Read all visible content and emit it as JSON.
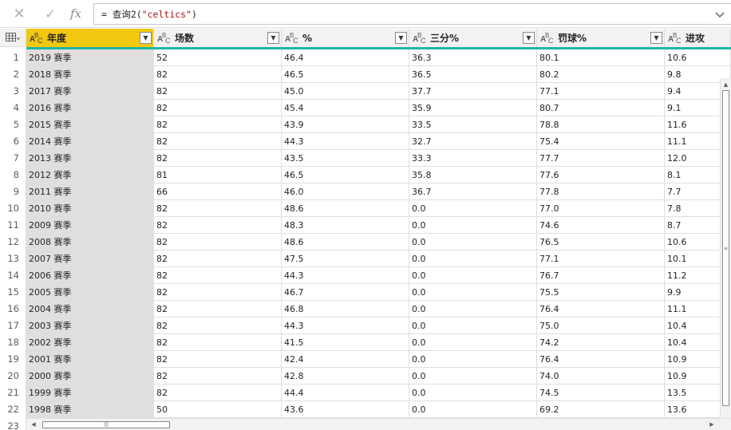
{
  "formula_bar": {
    "cancel_icon": "close-icon",
    "commit_icon": "check-icon",
    "fx_label": "fx",
    "formula_prefix": "= 查询2(",
    "formula_string": "\"celtics\"",
    "formula_suffix": ")"
  },
  "table": {
    "columns": [
      {
        "name": "年度",
        "type": "text",
        "selected": true
      },
      {
        "name": "场数",
        "type": "text"
      },
      {
        "name": "%",
        "type": "text"
      },
      {
        "name": "三分%",
        "type": "text"
      },
      {
        "name": "罚球%",
        "type": "text"
      },
      {
        "name": "进攻",
        "type": "text"
      }
    ],
    "rows": [
      {
        "n": "1",
        "c": [
          "2019 赛季",
          "52",
          "46.4",
          "36.3",
          "80.1",
          "10.6"
        ]
      },
      {
        "n": "2",
        "c": [
          "2018 赛季",
          "82",
          "46.5",
          "36.5",
          "80.2",
          "9.8"
        ]
      },
      {
        "n": "3",
        "c": [
          "2017 赛季",
          "82",
          "45.0",
          "37.7",
          "77.1",
          "9.4"
        ]
      },
      {
        "n": "4",
        "c": [
          "2016 赛季",
          "82",
          "45.4",
          "35.9",
          "80.7",
          "9.1"
        ]
      },
      {
        "n": "5",
        "c": [
          "2015 赛季",
          "82",
          "43.9",
          "33.5",
          "78.8",
          "11.6"
        ]
      },
      {
        "n": "6",
        "c": [
          "2014 赛季",
          "82",
          "44.3",
          "32.7",
          "75.4",
          "11.1"
        ]
      },
      {
        "n": "7",
        "c": [
          "2013 赛季",
          "82",
          "43.5",
          "33.3",
          "77.7",
          "12.0"
        ]
      },
      {
        "n": "8",
        "c": [
          "2012 赛季",
          "81",
          "46.5",
          "35.8",
          "77.6",
          "8.1"
        ]
      },
      {
        "n": "9",
        "c": [
          "2011 赛季",
          "66",
          "46.0",
          "36.7",
          "77.8",
          "7.7"
        ]
      },
      {
        "n": "10",
        "c": [
          "2010 赛季",
          "82",
          "48.6",
          "0.0",
          "77.0",
          "7.8"
        ]
      },
      {
        "n": "11",
        "c": [
          "2009 赛季",
          "82",
          "48.3",
          "0.0",
          "74.6",
          "8.7"
        ]
      },
      {
        "n": "12",
        "c": [
          "2008 赛季",
          "82",
          "48.6",
          "0.0",
          "76.5",
          "10.6"
        ]
      },
      {
        "n": "13",
        "c": [
          "2007 赛季",
          "82",
          "47.5",
          "0.0",
          "77.1",
          "10.1"
        ]
      },
      {
        "n": "14",
        "c": [
          "2006 赛季",
          "82",
          "44.3",
          "0.0",
          "76.7",
          "11.2"
        ]
      },
      {
        "n": "15",
        "c": [
          "2005 赛季",
          "82",
          "46.7",
          "0.0",
          "75.5",
          "9.9"
        ]
      },
      {
        "n": "16",
        "c": [
          "2004 赛季",
          "82",
          "46.8",
          "0.0",
          "76.4",
          "11.1"
        ]
      },
      {
        "n": "17",
        "c": [
          "2003 赛季",
          "82",
          "44.3",
          "0.0",
          "75.0",
          "10.4"
        ]
      },
      {
        "n": "18",
        "c": [
          "2002 赛季",
          "82",
          "41.5",
          "0.0",
          "74.2",
          "10.4"
        ]
      },
      {
        "n": "19",
        "c": [
          "2001 赛季",
          "82",
          "42.4",
          "0.0",
          "76.4",
          "10.9"
        ]
      },
      {
        "n": "20",
        "c": [
          "2000 赛季",
          "82",
          "42.8",
          "0.0",
          "74.0",
          "10.9"
        ]
      },
      {
        "n": "21",
        "c": [
          "1999 赛季",
          "82",
          "44.4",
          "0.0",
          "74.5",
          "13.5"
        ]
      },
      {
        "n": "22",
        "c": [
          "1998 赛季",
          "50",
          "43.6",
          "0.0",
          "69.2",
          "13.6"
        ]
      },
      {
        "n": "23",
        "c": [
          "",
          "",
          "",
          "",
          "",
          ""
        ]
      }
    ]
  },
  "colors": {
    "selected_header": "#f2c811",
    "header_underline": "#23b5a9",
    "selected_column_cells": "#e1dfdd",
    "formula_string": "#a31515"
  }
}
